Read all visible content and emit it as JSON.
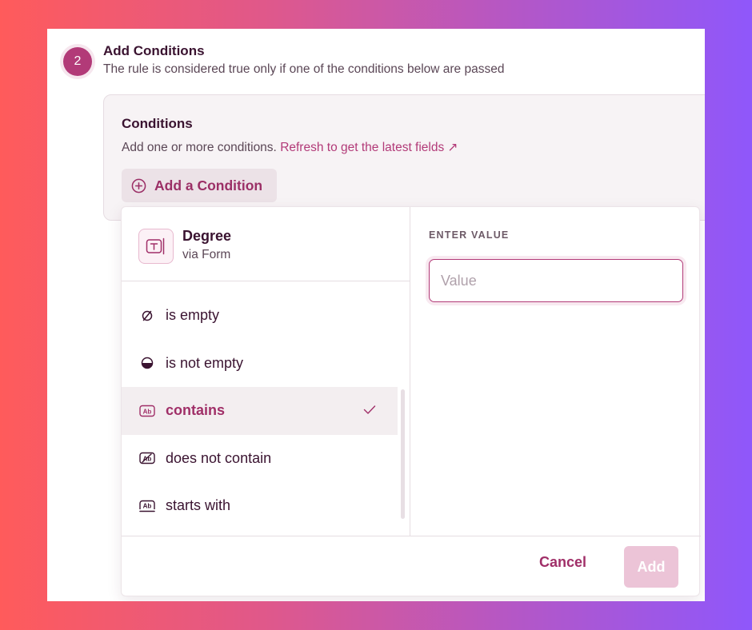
{
  "step": {
    "number": "2",
    "title": "Add Conditions",
    "subtitle": "The rule is considered true only if one of the conditions below are passed"
  },
  "conditions": {
    "title": "Conditions",
    "description": "Add one or more conditions.",
    "refresh_link": "Refresh to get the latest fields ↗",
    "add_button": "Add a Condition"
  },
  "field": {
    "name": "Degree",
    "source": "via Form",
    "icon": "text-field-icon"
  },
  "operators": [
    {
      "label": "is empty",
      "icon": "empty-set-icon",
      "selected": false
    },
    {
      "label": "is not empty",
      "icon": "half-circle-icon",
      "selected": false
    },
    {
      "label": "contains",
      "icon": "ab-text-icon",
      "selected": true
    },
    {
      "label": "does not contain",
      "icon": "ab-strikethrough-icon",
      "selected": false
    },
    {
      "label": "starts with",
      "icon": "ab-underline-icon",
      "selected": false
    }
  ],
  "value": {
    "label": "ENTER VALUE",
    "placeholder": "Value",
    "current": ""
  },
  "footer": {
    "cancel": "Cancel",
    "add": "Add"
  },
  "colors": {
    "accent": "#b23a78",
    "accent_disabled": "#ecc4d7",
    "text_dark": "#3a1330"
  }
}
